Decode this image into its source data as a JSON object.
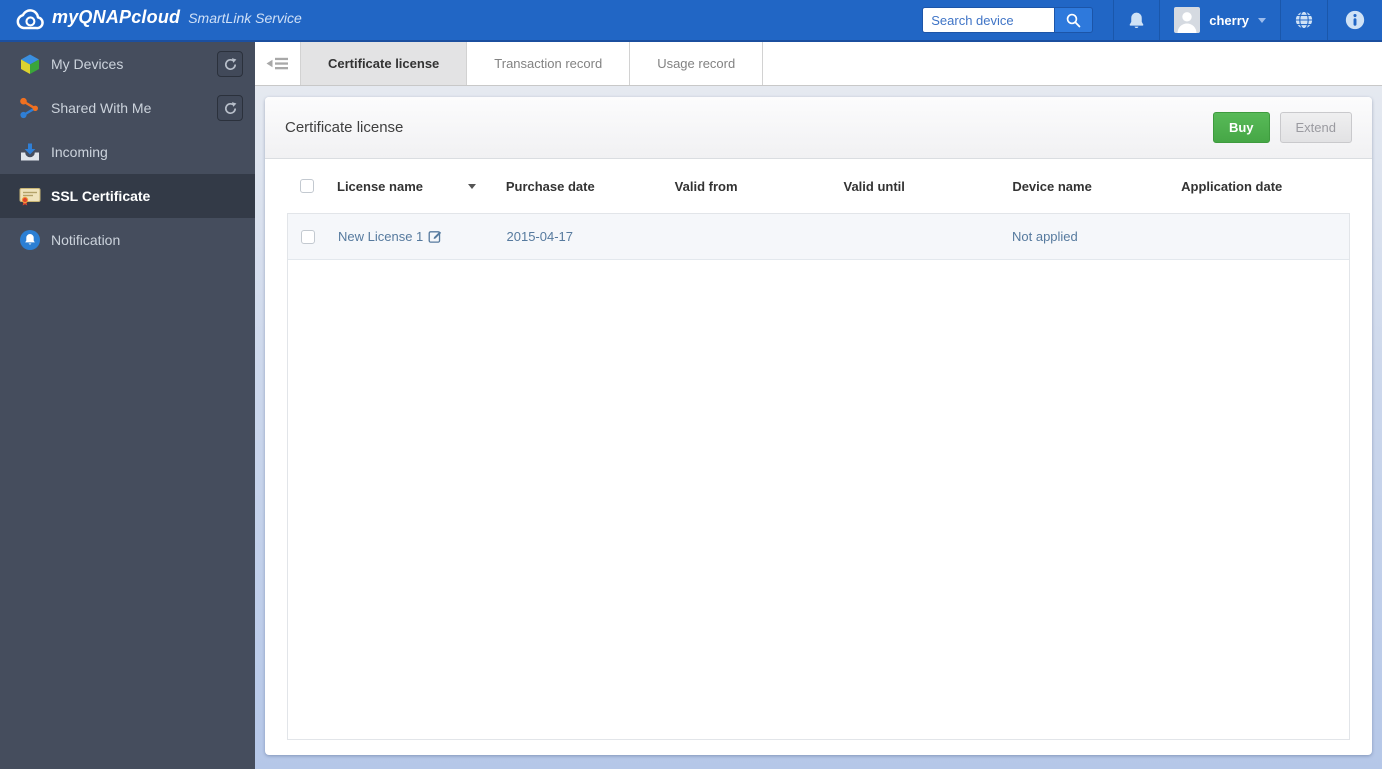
{
  "topbar": {
    "brand": "myQNAPcloud",
    "product": "SmartLink Service",
    "search_placeholder": "Search device",
    "username": "cherry"
  },
  "sidebar": {
    "items": [
      {
        "label": "My Devices",
        "icon": "devices-cube-icon",
        "has_refresh": true,
        "active": false
      },
      {
        "label": "Shared With Me",
        "icon": "share-icon",
        "has_refresh": true,
        "active": false
      },
      {
        "label": "Incoming",
        "icon": "incoming-tray-icon",
        "has_refresh": false,
        "active": false
      },
      {
        "label": "SSL Certificate",
        "icon": "certificate-icon",
        "has_refresh": false,
        "active": true
      },
      {
        "label": "Notification",
        "icon": "notification-bell-icon",
        "has_refresh": false,
        "active": false
      }
    ]
  },
  "tabs": [
    {
      "label": "Certificate license",
      "active": true
    },
    {
      "label": "Transaction record",
      "active": false
    },
    {
      "label": "Usage record",
      "active": false
    }
  ],
  "panel": {
    "title": "Certificate license",
    "buy_label": "Buy",
    "extend_label": "Extend"
  },
  "table": {
    "columns": [
      "License name",
      "Purchase date",
      "Valid from",
      "Valid until",
      "Device name",
      "Application date"
    ],
    "rows": [
      {
        "license_name": "New License 1",
        "purchase_date": "2015-04-17",
        "valid_from": "",
        "valid_until": "",
        "device_name": "Not applied",
        "application_date": ""
      }
    ]
  },
  "colors": {
    "topbar_blue": "#2166c5",
    "sidebar_dark": "#454d5d",
    "sidebar_active": "#333a47",
    "accent_green": "#46a746",
    "row_text_blue": "#567a9e",
    "content_gradient_bottom": "#b5c7e8",
    "active_tab_gray": "#e3e3e4"
  }
}
